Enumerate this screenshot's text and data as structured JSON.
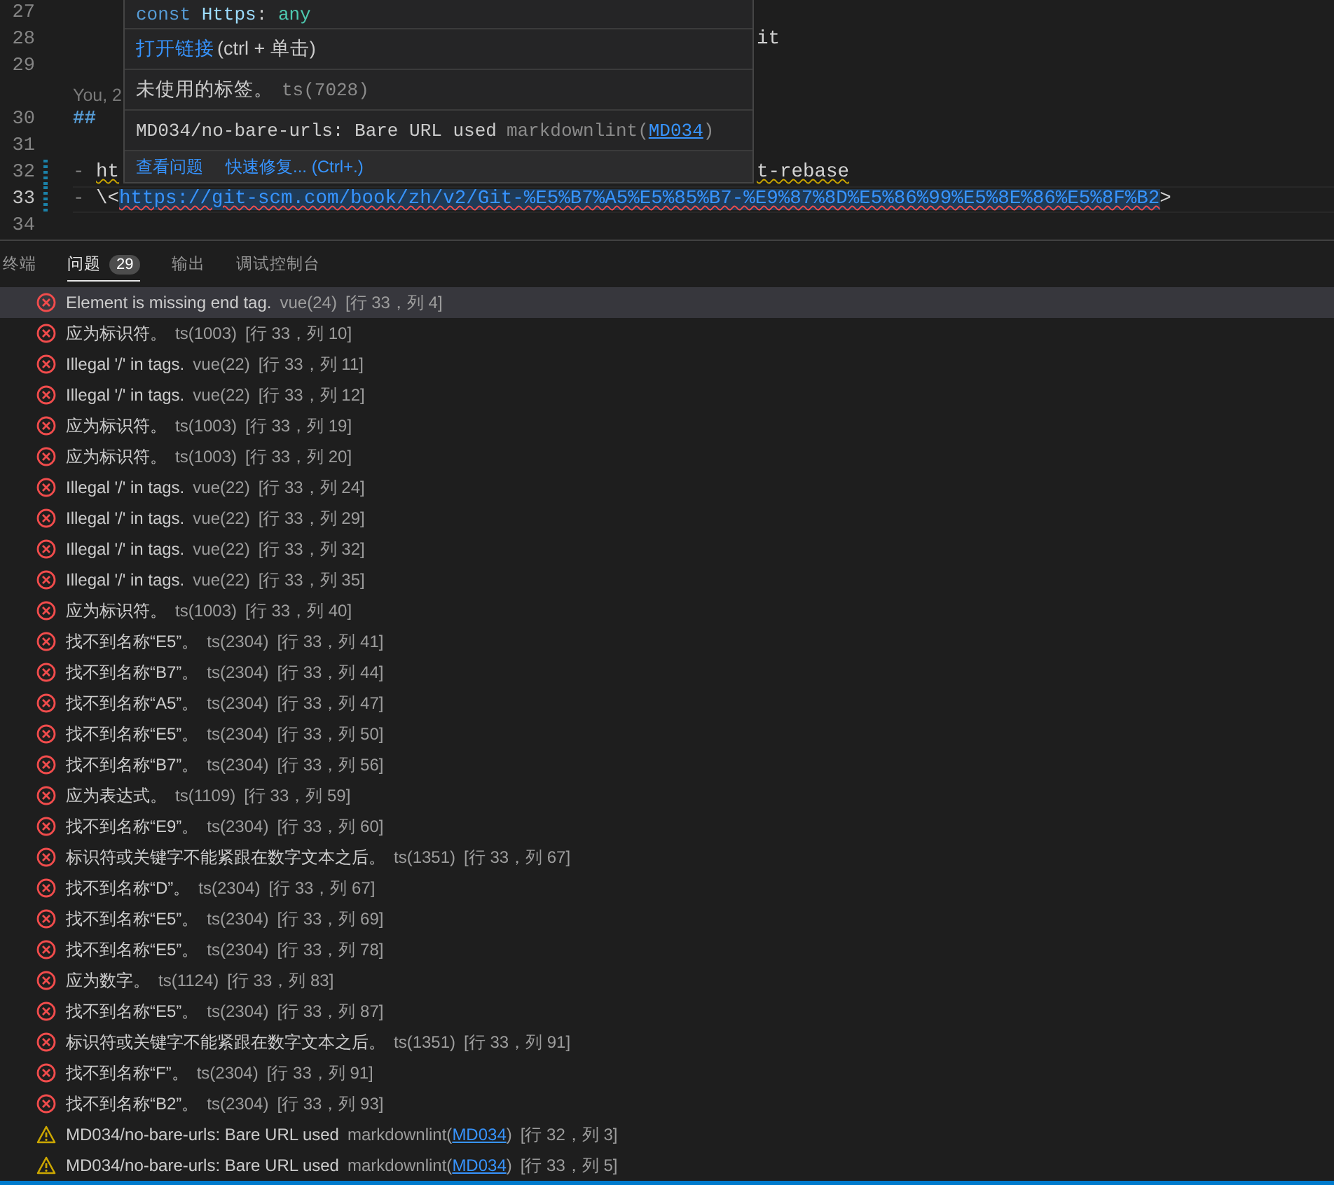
{
  "editor": {
    "lines": [
      {
        "number": "27",
        "current": false,
        "changed": false
      },
      {
        "number": "28",
        "current": false,
        "changed": false,
        "tail": [
          {
            "text": "it",
            "kind": "plain"
          }
        ]
      },
      {
        "number": "29",
        "current": false,
        "changed": false
      },
      {
        "kind": "blame",
        "segments": [
          {
            "text": "You, 2",
            "kind": "blame"
          }
        ]
      },
      {
        "number": "30",
        "current": false,
        "changed": false,
        "segments": [
          {
            "text": "##",
            "kind": "heading"
          }
        ]
      },
      {
        "number": "31",
        "current": false,
        "changed": false
      },
      {
        "number": "32",
        "current": false,
        "changed": true,
        "segments": [
          {
            "text": "- ",
            "kind": "punct"
          },
          {
            "text": "ht",
            "kind": "warned"
          }
        ],
        "tail": [
          {
            "text": "t-rebase",
            "kind": "warned"
          }
        ]
      },
      {
        "number": "33",
        "current": true,
        "changed": true,
        "segments": [
          {
            "text": "- ",
            "kind": "punct"
          },
          {
            "text": "\\<",
            "kind": "plain"
          },
          {
            "text": "https://git-scm.com/book/zh/v2/Git-%E5%B7%A5%E5%85%B7-%E9%87%8D%E5%86%99%E5%8E%86%E5%8F%B2",
            "kind": "url"
          },
          {
            "text": ">",
            "kind": "plain"
          }
        ]
      },
      {
        "number": "34",
        "current": false,
        "changed": false
      }
    ]
  },
  "hover": {
    "code": [
      {
        "text": "const",
        "kind": "keyword"
      },
      {
        "text": " Https",
        "kind": "variable"
      },
      {
        "text": ": ",
        "kind": "plain"
      },
      {
        "text": "any",
        "kind": "type"
      }
    ],
    "link": {
      "text": "打开链接",
      "hint": "(ctrl + 单击)"
    },
    "message": {
      "text": "未使用的标签。",
      "source": "ts(7028)"
    },
    "lint": {
      "message": "MD034/no-bare-urls: Bare URL used",
      "source_prefix": "markdownlint(",
      "code": "MD034",
      "source_suffix": ")"
    },
    "actions": [
      {
        "label": "查看问题"
      },
      {
        "label": "快速修复... (Ctrl+.)"
      }
    ]
  },
  "panel": {
    "tabs": [
      {
        "label": "终端",
        "selected": false
      },
      {
        "label": "问题",
        "selected": true,
        "badge": "29"
      },
      {
        "label": "输出",
        "selected": false
      },
      {
        "label": "调试控制台",
        "selected": false
      }
    ],
    "problems": [
      {
        "kind": "error",
        "selected": true,
        "message": "Element is missing end tag.",
        "source": "vue(24)",
        "location": "[行 33，列 4]"
      },
      {
        "kind": "error",
        "selected": false,
        "message": "应为标识符。",
        "source": "ts(1003)",
        "location": "[行 33，列 10]"
      },
      {
        "kind": "error",
        "selected": false,
        "message": "Illegal '/' in tags.",
        "source": "vue(22)",
        "location": "[行 33，列 11]"
      },
      {
        "kind": "error",
        "selected": false,
        "message": "Illegal '/' in tags.",
        "source": "vue(22)",
        "location": "[行 33，列 12]"
      },
      {
        "kind": "error",
        "selected": false,
        "message": "应为标识符。",
        "source": "ts(1003)",
        "location": "[行 33，列 19]"
      },
      {
        "kind": "error",
        "selected": false,
        "message": "应为标识符。",
        "source": "ts(1003)",
        "location": "[行 33，列 20]"
      },
      {
        "kind": "error",
        "selected": false,
        "message": "Illegal '/' in tags.",
        "source": "vue(22)",
        "location": "[行 33，列 24]"
      },
      {
        "kind": "error",
        "selected": false,
        "message": "Illegal '/' in tags.",
        "source": "vue(22)",
        "location": "[行 33，列 29]"
      },
      {
        "kind": "error",
        "selected": false,
        "message": "Illegal '/' in tags.",
        "source": "vue(22)",
        "location": "[行 33，列 32]"
      },
      {
        "kind": "error",
        "selected": false,
        "message": "Illegal '/' in tags.",
        "source": "vue(22)",
        "location": "[行 33，列 35]"
      },
      {
        "kind": "error",
        "selected": false,
        "message": "应为标识符。",
        "source": "ts(1003)",
        "location": "[行 33，列 40]"
      },
      {
        "kind": "error",
        "selected": false,
        "message": "找不到名称“E5”。",
        "source": "ts(2304)",
        "location": "[行 33，列 41]"
      },
      {
        "kind": "error",
        "selected": false,
        "message": "找不到名称“B7”。",
        "source": "ts(2304)",
        "location": "[行 33，列 44]"
      },
      {
        "kind": "error",
        "selected": false,
        "message": "找不到名称“A5”。",
        "source": "ts(2304)",
        "location": "[行 33，列 47]"
      },
      {
        "kind": "error",
        "selected": false,
        "message": "找不到名称“E5”。",
        "source": "ts(2304)",
        "location": "[行 33，列 50]"
      },
      {
        "kind": "error",
        "selected": false,
        "message": "找不到名称“B7”。",
        "source": "ts(2304)",
        "location": "[行 33，列 56]"
      },
      {
        "kind": "error",
        "selected": false,
        "message": "应为表达式。",
        "source": "ts(1109)",
        "location": "[行 33，列 59]"
      },
      {
        "kind": "error",
        "selected": false,
        "message": "找不到名称“E9”。",
        "source": "ts(2304)",
        "location": "[行 33，列 60]"
      },
      {
        "kind": "error",
        "selected": false,
        "message": "标识符或关键字不能紧跟在数字文本之后。",
        "source": "ts(1351)",
        "location": "[行 33，列 67]"
      },
      {
        "kind": "error",
        "selected": false,
        "message": "找不到名称“D”。",
        "source": "ts(2304)",
        "location": "[行 33，列 67]"
      },
      {
        "kind": "error",
        "selected": false,
        "message": "找不到名称“E5”。",
        "source": "ts(2304)",
        "location": "[行 33，列 69]"
      },
      {
        "kind": "error",
        "selected": false,
        "message": "找不到名称“E5”。",
        "source": "ts(2304)",
        "location": "[行 33，列 78]"
      },
      {
        "kind": "error",
        "selected": false,
        "message": "应为数字。",
        "source": "ts(1124)",
        "location": "[行 33，列 83]"
      },
      {
        "kind": "error",
        "selected": false,
        "message": "找不到名称“E5”。",
        "source": "ts(2304)",
        "location": "[行 33，列 87]"
      },
      {
        "kind": "error",
        "selected": false,
        "message": "标识符或关键字不能紧跟在数字文本之后。",
        "source": "ts(1351)",
        "location": "[行 33，列 91]"
      },
      {
        "kind": "error",
        "selected": false,
        "message": "找不到名称“F”。",
        "source": "ts(2304)",
        "location": "[行 33，列 91]"
      },
      {
        "kind": "error",
        "selected": false,
        "message": "找不到名称“B2”。",
        "source": "ts(2304)",
        "location": "[行 33，列 93]"
      },
      {
        "kind": "warning",
        "selected": false,
        "message": "MD034/no-bare-urls: Bare URL used",
        "source": "markdownlint(",
        "code": "MD034",
        "source_suffix": ")",
        "location": "[行 32，列 3]"
      },
      {
        "kind": "warning",
        "selected": false,
        "message": "MD034/no-bare-urls: Bare URL used",
        "source": "markdownlint(",
        "code": "MD034",
        "source_suffix": ")",
        "location": "[行 33，列 5]"
      }
    ]
  }
}
